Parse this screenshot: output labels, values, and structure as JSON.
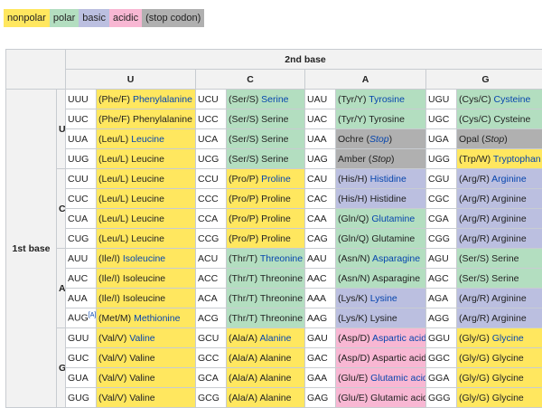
{
  "legend": [
    {
      "label": "nonpolar",
      "cls": "np"
    },
    {
      "label": "polar",
      "cls": "po"
    },
    {
      "label": "basic",
      "cls": "ba"
    },
    {
      "label": "acidic",
      "cls": "ac"
    },
    {
      "label": "(stop codon)",
      "cls": "st"
    }
  ],
  "table": {
    "second_base_label": "2nd base",
    "first_base_label": "1st base",
    "columns": [
      "U",
      "C",
      "A",
      "G"
    ],
    "groups": [
      {
        "base": "U",
        "rows": [
          [
            {
              "codon": "UUU",
              "abbr": "(Phe/F) ",
              "name": "Phenylalanine",
              "cls": "np",
              "link": true
            },
            {
              "codon": "UCU",
              "abbr": "(Ser/S) ",
              "name": "Serine",
              "cls": "po",
              "link": true
            },
            {
              "codon": "UAU",
              "abbr": "(Tyr/Y) ",
              "name": "Tyrosine",
              "cls": "po",
              "link": true
            },
            {
              "codon": "UGU",
              "abbr": "(Cys/C) ",
              "name": "Cysteine",
              "cls": "po",
              "link": true
            }
          ],
          [
            {
              "codon": "UUC",
              "abbr": "(Phe/F) ",
              "name": "Phenylalanine",
              "cls": "np",
              "link": false
            },
            {
              "codon": "UCC",
              "abbr": "(Ser/S) ",
              "name": "Serine",
              "cls": "po",
              "link": false
            },
            {
              "codon": "UAC",
              "abbr": "(Tyr/Y) ",
              "name": "Tyrosine",
              "cls": "po",
              "link": false
            },
            {
              "codon": "UGC",
              "abbr": "(Cys/C) ",
              "name": "Cysteine",
              "cls": "po",
              "link": false
            }
          ],
          [
            {
              "codon": "UUA",
              "abbr": "(Leu/L) ",
              "name": "Leucine",
              "cls": "np",
              "link": true
            },
            {
              "codon": "UCA",
              "abbr": "(Ser/S) ",
              "name": "Serine",
              "cls": "po",
              "link": false
            },
            {
              "codon": "UAA",
              "abbr": "Ochre (",
              "name": "Stop",
              "suffix": ")",
              "cls": "st",
              "link": true,
              "italic": true
            },
            {
              "codon": "UGA",
              "abbr": "Opal (",
              "name": "Stop",
              "suffix": ")",
              "cls": "st",
              "link": false,
              "italic": true
            }
          ],
          [
            {
              "codon": "UUG",
              "abbr": "(Leu/L) ",
              "name": "Leucine",
              "cls": "np",
              "link": false
            },
            {
              "codon": "UCG",
              "abbr": "(Ser/S) ",
              "name": "Serine",
              "cls": "po",
              "link": false
            },
            {
              "codon": "UAG",
              "abbr": "Amber (",
              "name": "Stop",
              "suffix": ")",
              "cls": "st",
              "link": false,
              "italic": true
            },
            {
              "codon": "UGG",
              "abbr": "(Trp/W) ",
              "name": "Tryptophan",
              "cls": "np",
              "link": true
            }
          ]
        ]
      },
      {
        "base": "C",
        "rows": [
          [
            {
              "codon": "CUU",
              "abbr": "(Leu/L) ",
              "name": "Leucine",
              "cls": "np",
              "link": false
            },
            {
              "codon": "CCU",
              "abbr": "(Pro/P) ",
              "name": "Proline",
              "cls": "np",
              "link": true
            },
            {
              "codon": "CAU",
              "abbr": "(His/H) ",
              "name": "Histidine",
              "cls": "ba",
              "link": true
            },
            {
              "codon": "CGU",
              "abbr": "(Arg/R) ",
              "name": "Arginine",
              "cls": "ba",
              "link": true
            }
          ],
          [
            {
              "codon": "CUC",
              "abbr": "(Leu/L) ",
              "name": "Leucine",
              "cls": "np",
              "link": false
            },
            {
              "codon": "CCC",
              "abbr": "(Pro/P) ",
              "name": "Proline",
              "cls": "np",
              "link": false
            },
            {
              "codon": "CAC",
              "abbr": "(His/H) ",
              "name": "Histidine",
              "cls": "ba",
              "link": false
            },
            {
              "codon": "CGC",
              "abbr": "(Arg/R) ",
              "name": "Arginine",
              "cls": "ba",
              "link": false
            }
          ],
          [
            {
              "codon": "CUA",
              "abbr": "(Leu/L) ",
              "name": "Leucine",
              "cls": "np",
              "link": false
            },
            {
              "codon": "CCA",
              "abbr": "(Pro/P) ",
              "name": "Proline",
              "cls": "np",
              "link": false
            },
            {
              "codon": "CAA",
              "abbr": "(Gln/Q) ",
              "name": "Glutamine",
              "cls": "po",
              "link": true
            },
            {
              "codon": "CGA",
              "abbr": "(Arg/R) ",
              "name": "Arginine",
              "cls": "ba",
              "link": false
            }
          ],
          [
            {
              "codon": "CUG",
              "abbr": "(Leu/L) ",
              "name": "Leucine",
              "cls": "np",
              "link": false
            },
            {
              "codon": "CCG",
              "abbr": "(Pro/P) ",
              "name": "Proline",
              "cls": "np",
              "link": false
            },
            {
              "codon": "CAG",
              "abbr": "(Gln/Q) ",
              "name": "Glutamine",
              "cls": "po",
              "link": false
            },
            {
              "codon": "CGG",
              "abbr": "(Arg/R) ",
              "name": "Arginine",
              "cls": "ba",
              "link": false
            }
          ]
        ]
      },
      {
        "base": "A",
        "rows": [
          [
            {
              "codon": "AUU",
              "abbr": "(Ile/I) ",
              "name": "Isoleucine",
              "cls": "np",
              "link": true
            },
            {
              "codon": "ACU",
              "abbr": "(Thr/T) ",
              "name": "Threonine",
              "cls": "po",
              "link": true
            },
            {
              "codon": "AAU",
              "abbr": "(Asn/N) ",
              "name": "Asparagine",
              "cls": "po",
              "link": true
            },
            {
              "codon": "AGU",
              "abbr": "(Ser/S) ",
              "name": "Serine",
              "cls": "po",
              "link": false
            }
          ],
          [
            {
              "codon": "AUC",
              "abbr": "(Ile/I) ",
              "name": "Isoleucine",
              "cls": "np",
              "link": false
            },
            {
              "codon": "ACC",
              "abbr": "(Thr/T) ",
              "name": "Threonine",
              "cls": "po",
              "link": false
            },
            {
              "codon": "AAC",
              "abbr": "(Asn/N) ",
              "name": "Asparagine",
              "cls": "po",
              "link": false
            },
            {
              "codon": "AGC",
              "abbr": "(Ser/S) ",
              "name": "Serine",
              "cls": "po",
              "link": false
            }
          ],
          [
            {
              "codon": "AUA",
              "abbr": "(Ile/I) ",
              "name": "Isoleucine",
              "cls": "np",
              "link": false
            },
            {
              "codon": "ACA",
              "abbr": "(Thr/T) ",
              "name": "Threonine",
              "cls": "po",
              "link": false
            },
            {
              "codon": "AAA",
              "abbr": "(Lys/K) ",
              "name": "Lysine",
              "cls": "ba",
              "link": true
            },
            {
              "codon": "AGA",
              "abbr": "(Arg/R) ",
              "name": "Arginine",
              "cls": "ba",
              "link": false
            }
          ],
          [
            {
              "codon": "AUG",
              "sup": "[A]",
              "abbr": "(Met/M) ",
              "name": "Methionine",
              "cls": "np",
              "link": true
            },
            {
              "codon": "ACG",
              "abbr": "(Thr/T) ",
              "name": "Threonine",
              "cls": "po",
              "link": false
            },
            {
              "codon": "AAG",
              "abbr": "(Lys/K) ",
              "name": "Lysine",
              "cls": "ba",
              "link": false
            },
            {
              "codon": "AGG",
              "abbr": "(Arg/R) ",
              "name": "Arginine",
              "cls": "ba",
              "link": false
            }
          ]
        ]
      },
      {
        "base": "G",
        "rows": [
          [
            {
              "codon": "GUU",
              "abbr": "(Val/V) ",
              "name": "Valine",
              "cls": "np",
              "link": true
            },
            {
              "codon": "GCU",
              "abbr": "(Ala/A) ",
              "name": "Alanine",
              "cls": "np",
              "link": true
            },
            {
              "codon": "GAU",
              "abbr": "(Asp/D) ",
              "name": "Aspartic acid",
              "cls": "ac",
              "link": true
            },
            {
              "codon": "GGU",
              "abbr": "(Gly/G) ",
              "name": "Glycine",
              "cls": "np",
              "link": true
            }
          ],
          [
            {
              "codon": "GUC",
              "abbr": "(Val/V) ",
              "name": "Valine",
              "cls": "np",
              "link": false
            },
            {
              "codon": "GCC",
              "abbr": "(Ala/A) ",
              "name": "Alanine",
              "cls": "np",
              "link": false
            },
            {
              "codon": "GAC",
              "abbr": "(Asp/D) ",
              "name": "Aspartic acid",
              "cls": "ac",
              "link": false
            },
            {
              "codon": "GGC",
              "abbr": "(Gly/G) ",
              "name": "Glycine",
              "cls": "np",
              "link": false
            }
          ],
          [
            {
              "codon": "GUA",
              "abbr": "(Val/V) ",
              "name": "Valine",
              "cls": "np",
              "link": false
            },
            {
              "codon": "GCA",
              "abbr": "(Ala/A) ",
              "name": "Alanine",
              "cls": "np",
              "link": false
            },
            {
              "codon": "GAA",
              "abbr": "(Glu/E) ",
              "name": "Glutamic acid",
              "cls": "ac",
              "link": true
            },
            {
              "codon": "GGA",
              "abbr": "(Gly/G) ",
              "name": "Glycine",
              "cls": "np",
              "link": false
            }
          ],
          [
            {
              "codon": "GUG",
              "abbr": "(Val/V) ",
              "name": "Valine",
              "cls": "np",
              "link": false
            },
            {
              "codon": "GCG",
              "abbr": "(Ala/A) ",
              "name": "Alanine",
              "cls": "np",
              "link": false
            },
            {
              "codon": "GAG",
              "abbr": "(Glu/E) ",
              "name": "Glutamic acid",
              "cls": "ac",
              "link": false
            },
            {
              "codon": "GGG",
              "abbr": "(Gly/G) ",
              "name": "Glycine",
              "cls": "np",
              "link": false
            }
          ]
        ]
      }
    ]
  }
}
